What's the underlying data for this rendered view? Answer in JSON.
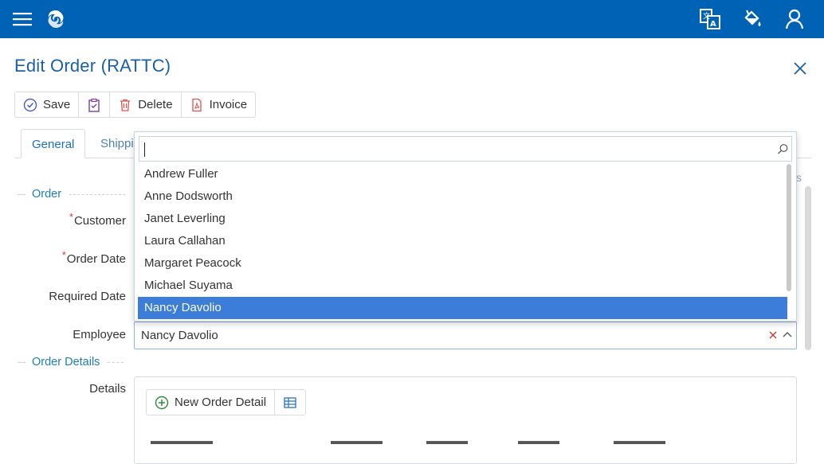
{
  "header": {
    "menu_icon": "hamburger-menu-icon",
    "logo_icon": "serenity-logo-icon",
    "right_icons": [
      "translate-icon",
      "theme-paint-bucket-icon",
      "user-profile-icon"
    ]
  },
  "page": {
    "title": "Edit Order (RATTC)"
  },
  "toolbar": {
    "save_label": "Save",
    "delete_label": "Delete",
    "invoice_label": "Invoice"
  },
  "tabs": {
    "general": "General",
    "shipping": "Shipping"
  },
  "sections": {
    "order": "Order",
    "order_details": "Order Details"
  },
  "form": {
    "customer_label": "Customer",
    "order_date_label": "Order Date",
    "required_date_label": "Required Date",
    "employee_label": "Employee",
    "employee_value": "Nancy Davolio",
    "details_label": "Details",
    "required_marker": "*"
  },
  "dropdown": {
    "search_value": "",
    "items": [
      "Andrew Fuller",
      "Anne Dodsworth",
      "Janet Leverling",
      "Laura Callahan",
      "Margaret Peacock",
      "Michael Suyama",
      "Nancy Davolio"
    ],
    "selected": "Nancy Davolio"
  },
  "details": {
    "new_button_label": "New Order Detail"
  },
  "colors": {
    "header_bg": "#0062b5",
    "title": "#1b5fa6",
    "section": "#1d7fb4",
    "selected_item_bg": "#3b7dd8",
    "required": "#e0393e",
    "delete_icon": "#d9534f",
    "invoice_icon": "#d9534f",
    "clipboard_icon": "#7a3fa8",
    "save_icon": "#4a5fb0",
    "add_icon": "#2e8b3e"
  }
}
